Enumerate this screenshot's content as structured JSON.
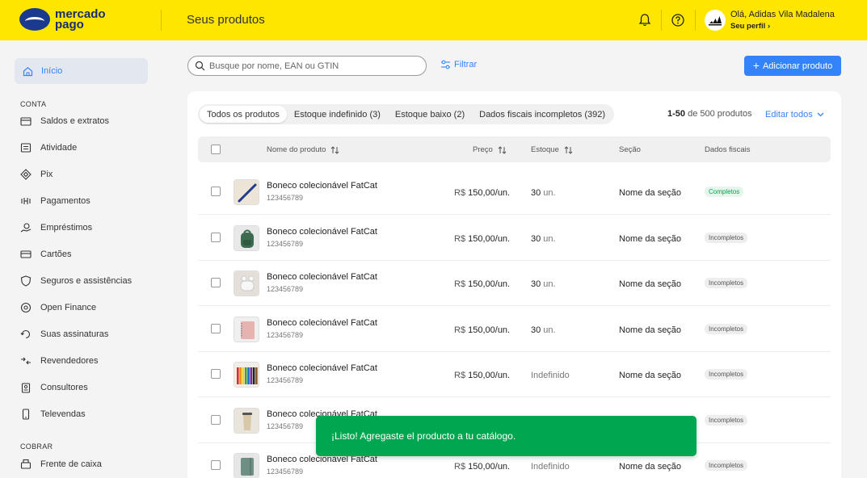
{
  "header": {
    "logo_line1": "mercado",
    "logo_line2": "pago",
    "page_title": "Seus produtos",
    "greeting": "Olá, Adidas Vila Madalena",
    "profile_link": "Seu perfil"
  },
  "sidebar": {
    "home": "Início",
    "section_conta": "CONTA",
    "conta_items": [
      {
        "label": "Saldos e extratos",
        "icon": "wallet-icon"
      },
      {
        "label": "Atividade",
        "icon": "activity-list-icon"
      },
      {
        "label": "Pix",
        "icon": "pix-icon"
      },
      {
        "label": "Pagamentos",
        "icon": "payments-icon"
      },
      {
        "label": "Empréstimos",
        "icon": "loans-icon"
      },
      {
        "label": "Cartões",
        "icon": "card-icon"
      },
      {
        "label": "Seguros e assistências",
        "icon": "shield-icon"
      },
      {
        "label": "Open Finance",
        "icon": "open-finance-icon"
      },
      {
        "label": "Suas assinaturas",
        "icon": "subscriptions-icon"
      },
      {
        "label": "Revendedores",
        "icon": "resellers-icon"
      },
      {
        "label": "Consultores",
        "icon": "consultants-icon"
      },
      {
        "label": "Televendas",
        "icon": "phone-icon"
      }
    ],
    "section_cobrar": "COBRAR",
    "cobrar_items": [
      {
        "label": "Frente de caixa",
        "icon": "cashier-icon"
      }
    ]
  },
  "toolbar": {
    "search_placeholder": "Busque por nome, EAN ou GTIN",
    "filter_label": "Filtrar",
    "add_label": "Adicionar produto"
  },
  "tabs": [
    {
      "label": "Todos os produtos",
      "active": true
    },
    {
      "label": "Estoque indefinido (3)",
      "active": false
    },
    {
      "label": "Estoque baixo (2)",
      "active": false
    },
    {
      "label": "Dados fiscais incompletos (392)",
      "active": false
    }
  ],
  "pagination": {
    "range": "1-50",
    "of_text": "de 500 produtos"
  },
  "edit_all_label": "Editar todos",
  "columns": {
    "name": "Nome do produto",
    "price": "Preço",
    "stock": "Estoque",
    "section": "Seção",
    "fiscal": "Dados fiscais"
  },
  "rows": [
    {
      "name": "Boneco colecionável FatCat",
      "sku": "123456789",
      "currency": "R$",
      "price": "150,00/un.",
      "stock": "30",
      "unit": "un.",
      "section": "Nome da seção",
      "fiscal": "Completos",
      "thumb": "pen-thumb"
    },
    {
      "name": "Boneco colecionável FatCat",
      "sku": "123456789",
      "currency": "R$",
      "price": "150,00/un.",
      "stock": "30",
      "unit": "un.",
      "section": "Nome da seção",
      "fiscal": "Incompletos",
      "thumb": "backpack-thumb"
    },
    {
      "name": "Boneco colecionável FatCat",
      "sku": "123456789",
      "currency": "R$",
      "price": "150,00/un.",
      "stock": "30",
      "unit": "un.",
      "section": "Nome da seção",
      "fiscal": "Incompletos",
      "thumb": "earbuds-thumb"
    },
    {
      "name": "Boneco colecionável FatCat",
      "sku": "123456789",
      "currency": "R$",
      "price": "150,00/un.",
      "stock": "30",
      "unit": "un.",
      "section": "Nome da seção",
      "fiscal": "Incompletos",
      "thumb": "notebook-thumb"
    },
    {
      "name": "Boneco colecionável FatCat",
      "sku": "123456789",
      "currency": "R$",
      "price": "150,00/un.",
      "stock": "Indefinido",
      "unit": "",
      "section": "Nome da seção",
      "fiscal": "Incompletos",
      "thumb": "pencils-thumb"
    },
    {
      "name": "Boneco colecionável FatCat",
      "sku": "123456789",
      "currency": "",
      "price": "",
      "stock": "",
      "unit": "",
      "section": "",
      "fiscal": "Incompletos",
      "thumb": "tumbler-thumb"
    },
    {
      "name": "Boneco colecionável FatCat",
      "sku": "123456789",
      "currency": "R$",
      "price": "150,00/un.",
      "stock": "Indefinido",
      "unit": "",
      "section": "Nome da seção",
      "fiscal": "Incompletos",
      "thumb": "green-notebook-thumb"
    }
  ],
  "toast": "¡Listo! Agregaste el producto a tu catálogo.",
  "colors": {
    "brand_yellow": "#ffe600",
    "accent_blue": "#3483fa",
    "success_green": "#00a650"
  }
}
